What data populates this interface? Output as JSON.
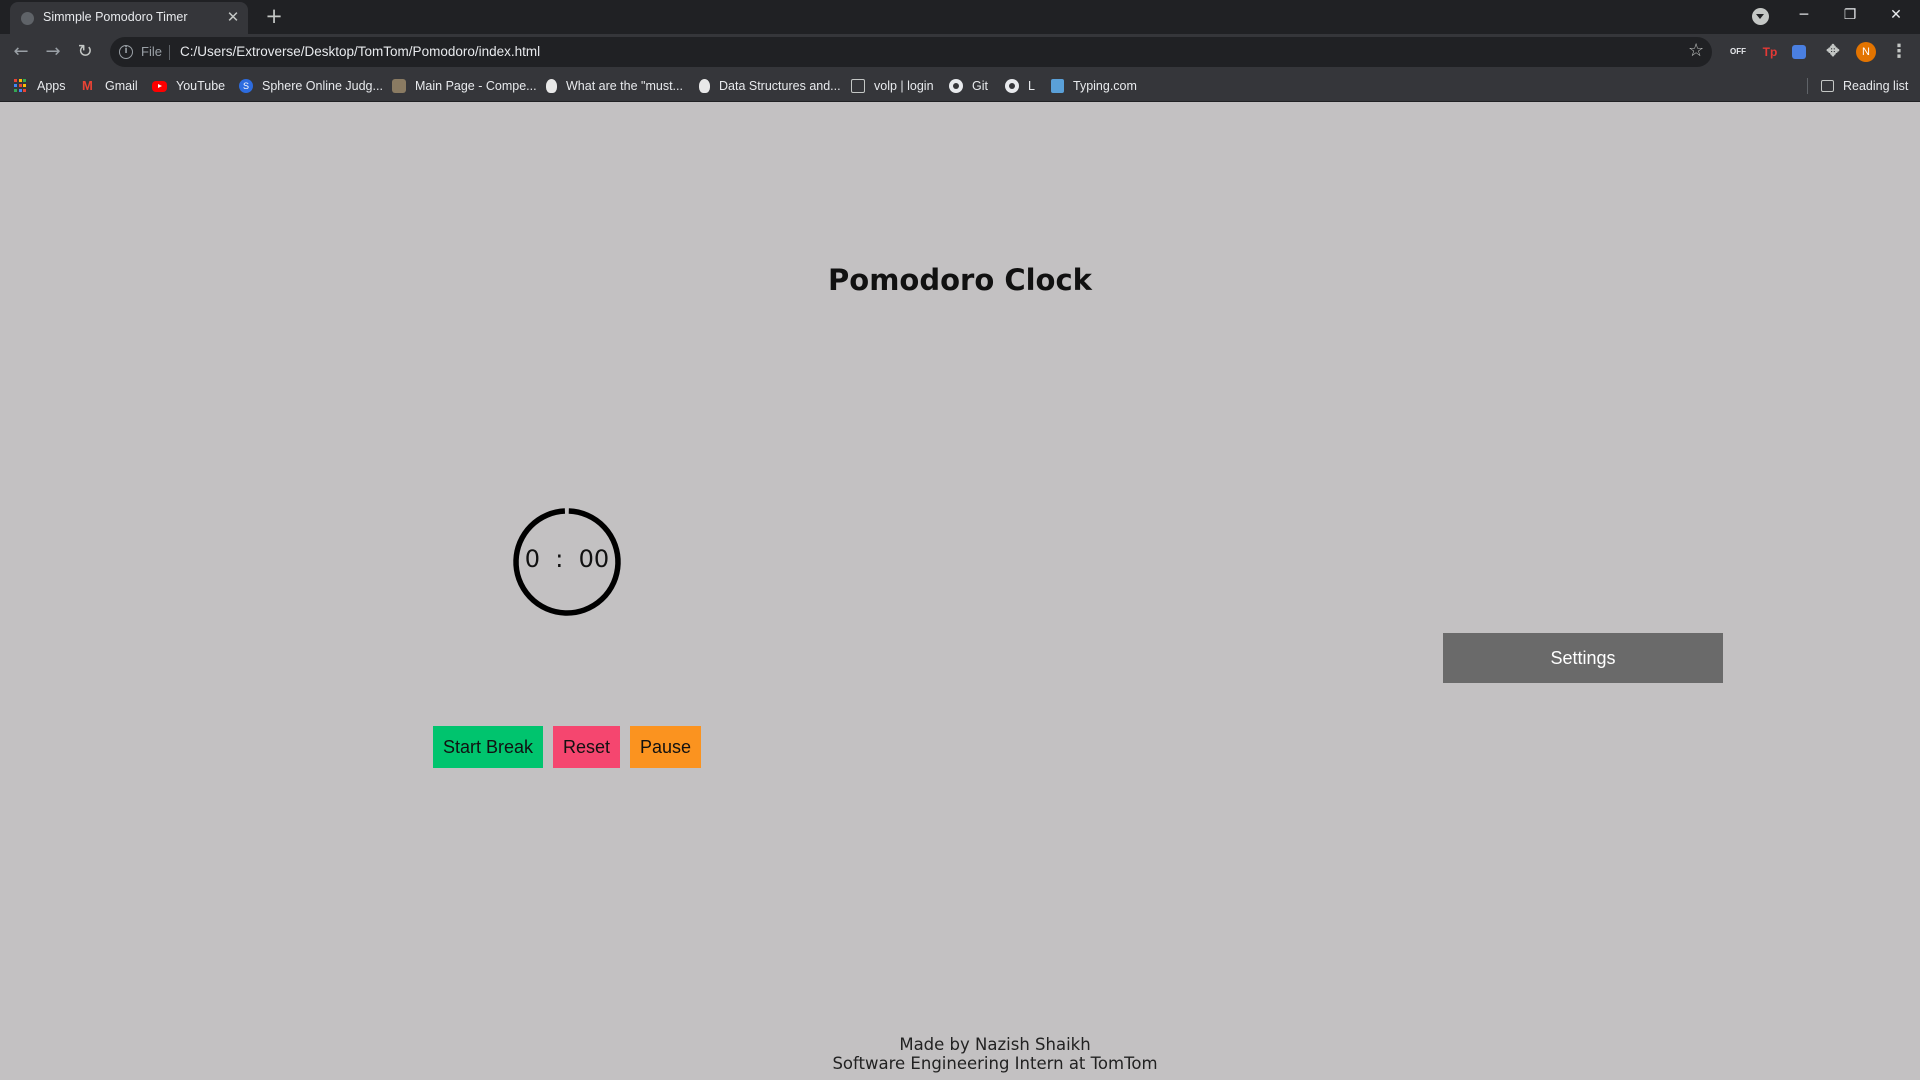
{
  "browser": {
    "tab": {
      "title": "Simmple Pomodoro Timer"
    },
    "address": {
      "scheme_label": "File",
      "url": "C:/Users/Extroverse/Desktop/TomTom/Pomodoro/index.html"
    },
    "profile_initial": "N",
    "extensions": [
      "OFF",
      "Tp"
    ],
    "bookmarks": [
      {
        "label": "Apps",
        "icon": "apps-grid-icon"
      },
      {
        "label": "Gmail",
        "icon": "gmail-icon"
      },
      {
        "label": "YouTube",
        "icon": "youtube-icon"
      },
      {
        "label": "Sphere Online Judg...",
        "icon": "sphere-icon"
      },
      {
        "label": "Main Page - Compe...",
        "icon": "wiki-icon"
      },
      {
        "label": "What are the \"must...",
        "icon": "quora-icon"
      },
      {
        "label": "Data Structures and...",
        "icon": "quora-icon"
      },
      {
        "label": "volp | login",
        "icon": "page-icon"
      },
      {
        "label": "Git",
        "icon": "github-icon"
      },
      {
        "label": "L",
        "icon": "github-icon"
      },
      {
        "label": "Typing.com",
        "icon": "typing-icon"
      }
    ],
    "reading_list": "Reading list"
  },
  "page": {
    "title": "Pomodoro Clock",
    "timer": {
      "minutes": "0",
      "separator": ":",
      "seconds": "00",
      "display": "0  :  00"
    },
    "buttons": {
      "start_break": "Start Break",
      "reset": "Reset",
      "pause": "Pause",
      "settings": "Settings"
    },
    "footer": {
      "line1": "Made by Nazish Shaikh",
      "line2": "Software Engineering Intern at TomTom"
    }
  },
  "colors": {
    "page_bg": "#c3c1c2",
    "start_break": "#00c46e",
    "reset": "#f5466f",
    "pause": "#fb931f",
    "settings": "#6a6a6a"
  }
}
